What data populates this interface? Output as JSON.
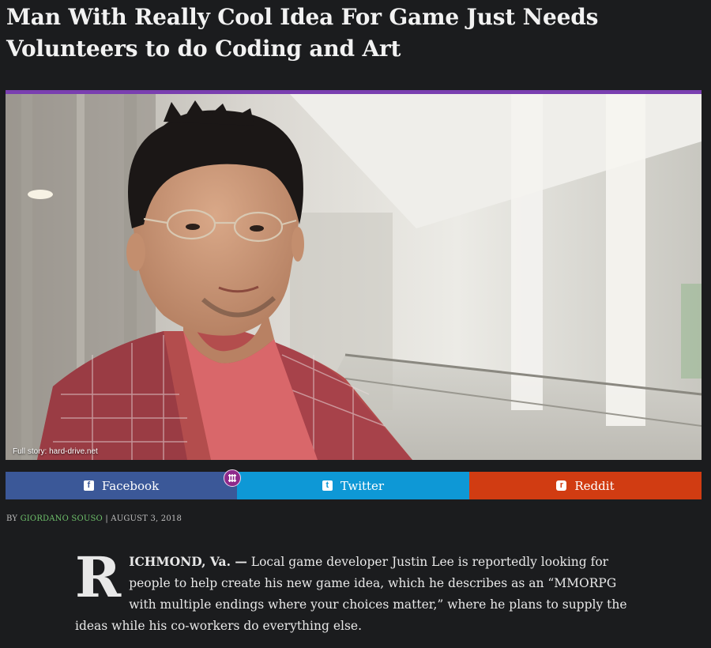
{
  "article": {
    "headline": "Man With Really Cool Idea For Game Just Needs Volunteers to do Coding and Art",
    "image_credit": "Full story: hard-drive.net",
    "byline_prefix": "BY",
    "author": "GIORDANO SOUSO",
    "separator": "|",
    "date": "AUGUST 3, 2018",
    "dropcap": "R",
    "dateline": "ICHMOND, Va. —",
    "body": " Local game developer Justin Lee is reportedly looking for people to help create his new game idea, which he describes as an “MMORPG with multiple endings where your choices matter,” where he plans to supply the ideas while his co-workers do everything else."
  },
  "share": {
    "facebook": {
      "label": "Facebook",
      "icon": "f",
      "color": "#3b5898"
    },
    "twitter": {
      "label": "Twitter",
      "icon": "t",
      "color": "#0e98d6"
    },
    "reddit": {
      "label": "Reddit",
      "icon": "r",
      "color": "#d13c12"
    }
  },
  "colors": {
    "background": "#1b1c1e",
    "accent_rule": "#7a3fb0",
    "author_link": "#6ec06a"
  }
}
